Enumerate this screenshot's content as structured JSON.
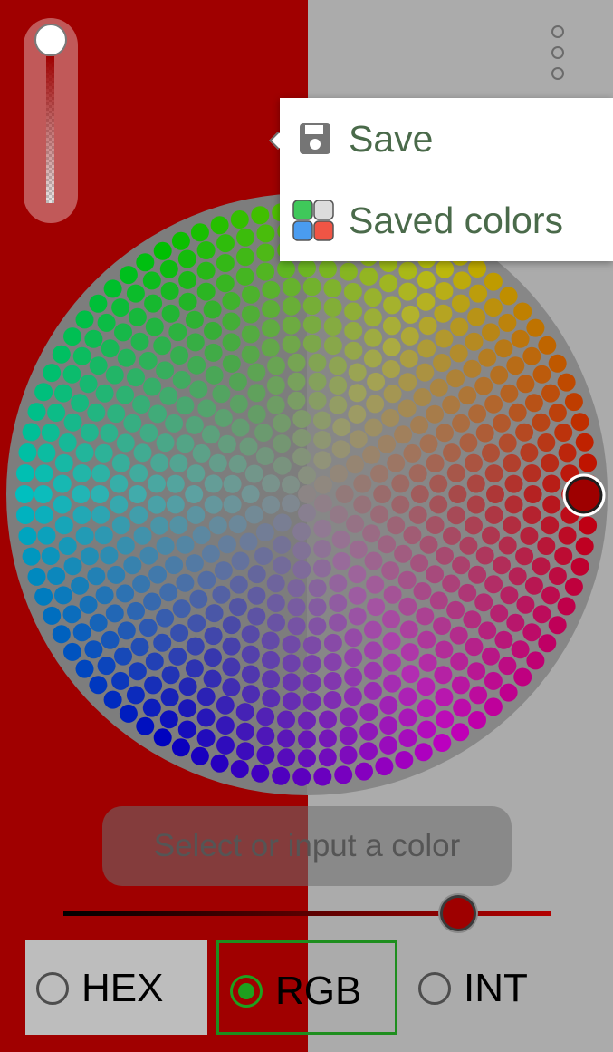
{
  "colors": {
    "selected": "#9e0000",
    "left_background": "#a00000",
    "right_background": "#ababab",
    "accent_green": "#1ea01e"
  },
  "menu": {
    "items": [
      {
        "icon": "floppy-disk-icon",
        "label": "Save"
      },
      {
        "icon": "color-palette-icon",
        "label": "Saved colors"
      }
    ]
  },
  "color_input": {
    "placeholder": "Select or input a color"
  },
  "brightness": {
    "value": 0.81
  },
  "alpha": {
    "value": 1.0
  },
  "formats": [
    {
      "label": "HEX",
      "selected": false
    },
    {
      "label": "RGB",
      "selected": true
    },
    {
      "label": "INT",
      "selected": false
    }
  ]
}
